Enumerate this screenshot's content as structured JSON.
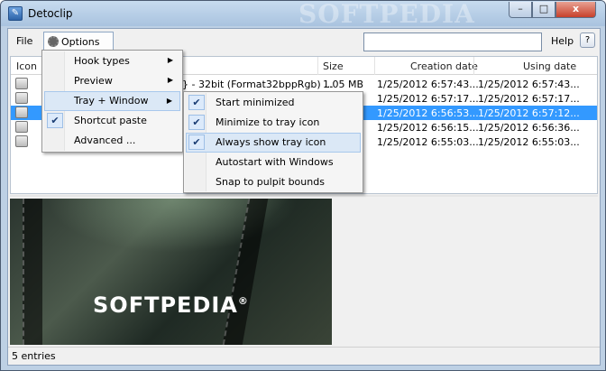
{
  "window": {
    "title": "Detoclip",
    "watermark": "SOFTPEDIA",
    "min_glyph": "–",
    "max_glyph": "□",
    "close_glyph": "x"
  },
  "menubar": {
    "file": "File",
    "options": "Options",
    "help": "Help",
    "help_btn": "?",
    "search_placeholder": ""
  },
  "list": {
    "columns": [
      "Icon",
      "",
      "Size",
      "Creation date",
      "Using date"
    ],
    "rows": [
      {
        "desc": "} - 32bit (Format32bppRgb) ...",
        "size": "1.05 MB",
        "created": "1/25/2012 6:57:43...",
        "used": "1/25/2012 6:57:43...",
        "selected": false
      },
      {
        "desc": "",
        "size": "",
        "created": "1/25/2012 6:57:17...",
        "used": "1/25/2012 6:57:17...",
        "selected": false
      },
      {
        "desc": "",
        "size": "",
        "created": "1/25/2012 6:56:53...",
        "used": "1/25/2012 6:57:12...",
        "selected": true
      },
      {
        "desc": "",
        "size": "",
        "created": "1/25/2012 6:56:15...",
        "used": "1/25/2012 6:56:36...",
        "selected": false
      },
      {
        "desc": "",
        "size": "",
        "created": "1/25/2012 6:55:03...",
        "used": "1/25/2012 6:55:03...",
        "selected": false
      }
    ]
  },
  "preview": {
    "logo": "SOFTPEDIA",
    "reg": "®"
  },
  "options_menu": {
    "items": [
      {
        "label": "Hook types",
        "submenu": true,
        "checked": false
      },
      {
        "label": "Preview",
        "submenu": true,
        "checked": false
      },
      {
        "label": "Tray + Window",
        "submenu": true,
        "checked": false,
        "highlighted": true
      },
      {
        "label": "Shortcut paste",
        "submenu": false,
        "checked": true
      },
      {
        "label": "Advanced ...",
        "submenu": false,
        "checked": false
      }
    ]
  },
  "tray_menu": {
    "items": [
      {
        "label": "Start minimized",
        "checked": true
      },
      {
        "label": "Minimize to tray icon",
        "checked": true
      },
      {
        "label": "Always show tray icon",
        "checked": true,
        "highlighted": true
      },
      {
        "label": "Autostart with Windows",
        "checked": false
      },
      {
        "label": "Snap to pulpit bounds",
        "checked": false
      }
    ]
  },
  "status": {
    "text": "5 entries"
  },
  "colors": {
    "selection": "#3399ff",
    "menu_highlight": "#dbe8f6",
    "titlebar": "#b9cfe7"
  }
}
